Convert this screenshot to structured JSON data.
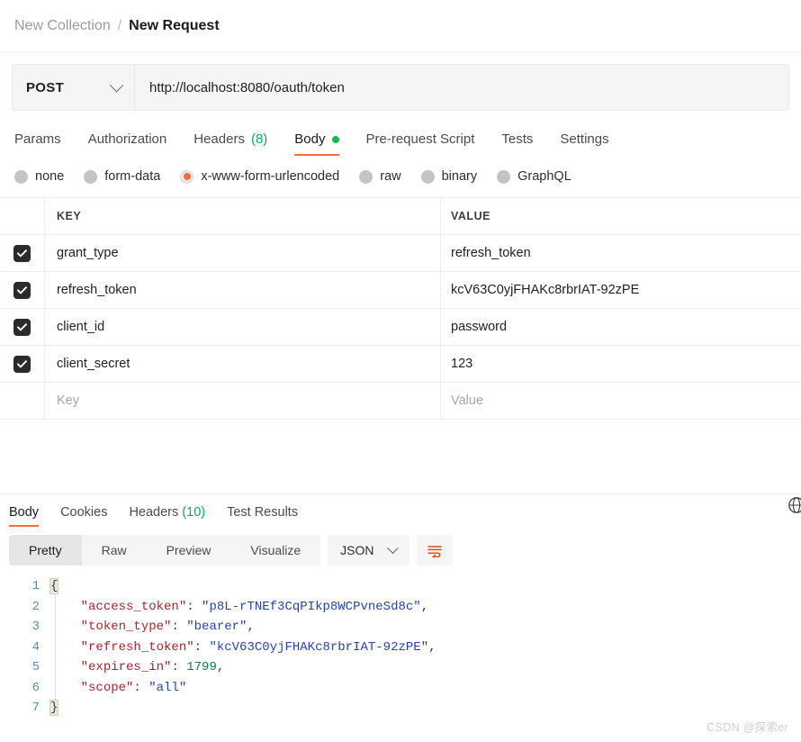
{
  "breadcrumb": {
    "collection": "New Collection",
    "separator": "/",
    "request": "New Request"
  },
  "url_bar": {
    "method": "POST",
    "url": "http://localhost:8080/oauth/token",
    "method_caret_icon": "chevron-down-icon"
  },
  "request_tabs": [
    {
      "label": "Params",
      "active": false
    },
    {
      "label": "Authorization",
      "active": false
    },
    {
      "label": "Headers",
      "count": "(8)",
      "active": false
    },
    {
      "label": "Body",
      "active": true,
      "dot": true
    },
    {
      "label": "Pre-request Script",
      "active": false
    },
    {
      "label": "Tests",
      "active": false
    },
    {
      "label": "Settings",
      "active": false
    }
  ],
  "body_types": [
    {
      "label": "none",
      "selected": false
    },
    {
      "label": "form-data",
      "selected": false
    },
    {
      "label": "x-www-form-urlencoded",
      "selected": true
    },
    {
      "label": "raw",
      "selected": false
    },
    {
      "label": "binary",
      "selected": false
    },
    {
      "label": "GraphQL",
      "selected": false
    }
  ],
  "kv_table": {
    "headers": {
      "key": "KEY",
      "value": "VALUE"
    },
    "rows": [
      {
        "checked": true,
        "key": "grant_type",
        "value": "refresh_token"
      },
      {
        "checked": true,
        "key": "refresh_token",
        "value": "kcV63C0yjFHAKc8rbrIAT-92zPE"
      },
      {
        "checked": true,
        "key": "client_id",
        "value": "password"
      },
      {
        "checked": true,
        "key": "client_secret",
        "value": "123"
      }
    ],
    "new_row": {
      "key_placeholder": "Key",
      "value_placeholder": "Value"
    }
  },
  "response_tabs": [
    {
      "label": "Body",
      "active": true
    },
    {
      "label": "Cookies",
      "active": false
    },
    {
      "label": "Headers",
      "count": "(10)",
      "active": false
    },
    {
      "label": "Test Results",
      "active": false
    }
  ],
  "response_right_icon": "globe-icon",
  "viewer": {
    "segments": [
      {
        "label": "Pretty",
        "active": true
      },
      {
        "label": "Raw",
        "active": false
      },
      {
        "label": "Preview",
        "active": false
      },
      {
        "label": "Visualize",
        "active": false
      }
    ],
    "format": "JSON",
    "format_caret_icon": "chevron-down-icon",
    "wrap_icon": "word-wrap-icon"
  },
  "response_body": {
    "line_numbers": [
      "1",
      "2",
      "3",
      "4",
      "5",
      "6",
      "7"
    ],
    "json": {
      "access_token": "p8L-rTNEf3CqPIkp8WCPvneSd8c",
      "token_type": "bearer",
      "refresh_token": "kcV63C0yjFHAKc8rbrIAT-92zPE",
      "expires_in": "1799",
      "scope": "all"
    },
    "tokens": {
      "open_brace": "{",
      "close_brace": "}",
      "k_access_token": "\"access_token\"",
      "v_access_token": "\"p8L-rTNEf3CqPIkp8WCPvneSd8c\"",
      "k_token_type": "\"token_type\"",
      "v_token_type": "\"bearer\"",
      "k_refresh_token": "\"refresh_token\"",
      "v_refresh_token": "\"kcV63C0yjFHAKc8rbrIAT-92zPE\"",
      "k_expires_in": "\"expires_in\"",
      "v_expires_in": "1799",
      "k_scope": "\"scope\"",
      "v_scope": "\"all\"",
      "colon_comma": ": ",
      "comma": ",",
      "colon": ": "
    }
  },
  "watermark": "CSDN @探索er",
  "colors": {
    "accent_orange": "#ff6c37",
    "green_dot": "#0cbb52",
    "count_green": "#0fa958",
    "json_key": "#a3262c",
    "json_string": "#2544a8",
    "json_number": "#0f7a52",
    "line_number": "#5b8bb5"
  }
}
